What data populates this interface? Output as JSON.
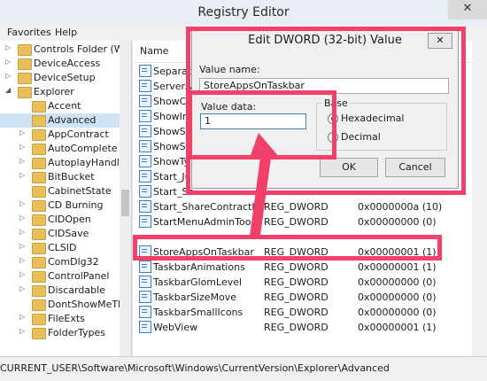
{
  "window": {
    "title": "Registry Editor",
    "close_glyph": "✕"
  },
  "menu": [
    "Favorites",
    "Help"
  ],
  "tree": [
    {
      "label": "Controls Folder (Wo",
      "level": 1,
      "arrow": "▷"
    },
    {
      "label": "DeviceAccess",
      "level": 1,
      "arrow": "▷"
    },
    {
      "label": "DeviceSetup",
      "level": 1,
      "arrow": "▷"
    },
    {
      "label": "Explorer",
      "level": 1,
      "arrow": "◢"
    },
    {
      "label": "Accent",
      "level": 2,
      "arrow": ""
    },
    {
      "label": "Advanced",
      "level": 2,
      "arrow": "",
      "selected": true
    },
    {
      "label": "AppContract",
      "level": 2,
      "arrow": "▷"
    },
    {
      "label": "AutoComplete",
      "level": 2,
      "arrow": "▷"
    },
    {
      "label": "AutoplayHandler",
      "level": 2,
      "arrow": "▷"
    },
    {
      "label": "BitBucket",
      "level": 2,
      "arrow": "▷"
    },
    {
      "label": "CabinetState",
      "level": 2,
      "arrow": ""
    },
    {
      "label": "CD Burning",
      "level": 2,
      "arrow": "▷"
    },
    {
      "label": "CIDOpen",
      "level": 2,
      "arrow": "▷"
    },
    {
      "label": "CIDSave",
      "level": 2,
      "arrow": "▷"
    },
    {
      "label": "CLSID",
      "level": 2,
      "arrow": "▷"
    },
    {
      "label": "ComDlg32",
      "level": 2,
      "arrow": "▷"
    },
    {
      "label": "ControlPanel",
      "level": 2,
      "arrow": "▷"
    },
    {
      "label": "Discardable",
      "level": 2,
      "arrow": "▷"
    },
    {
      "label": "DontShowMeThi",
      "level": 2,
      "arrow": ""
    },
    {
      "label": "FileExts",
      "level": 2,
      "arrow": "▷"
    },
    {
      "label": "FolderTypes",
      "level": 2,
      "arrow": "▷"
    }
  ],
  "list": {
    "header_name": "Name",
    "rows": [
      {
        "name": "Separat",
        "type": "",
        "data": ""
      },
      {
        "name": "ServerA",
        "type": "",
        "data": ""
      },
      {
        "name": "ShowCo",
        "type": "",
        "data": ""
      },
      {
        "name": "ShowInf",
        "type": "",
        "data": ""
      },
      {
        "name": "ShowSta",
        "type": "",
        "data": ""
      },
      {
        "name": "ShowSu",
        "type": "",
        "data": ""
      },
      {
        "name": "ShowTy",
        "type": "",
        "data": ""
      },
      {
        "name": "Start_Ju",
        "type": "",
        "data": ""
      },
      {
        "name": "Start_Se",
        "type": "",
        "data": ""
      },
      {
        "name": "Start_ShareContractH",
        "type": "REG_DWORD",
        "data": "0x0000000a (10)"
      },
      {
        "name": "StartMenuAdminToo",
        "type": "REG_DWORD",
        "data": "0x00000000 (0)"
      },
      {
        "name": "",
        "type": "",
        "data": ""
      },
      {
        "name": "StoreAppsOnTaskbar",
        "type": "REG_DWORD",
        "data": "0x00000001 (1)"
      },
      {
        "name": "TaskbarAnimations",
        "type": "REG_DWORD",
        "data": "0x00000001 (1)"
      },
      {
        "name": "TaskbarGlomLevel",
        "type": "REG_DWORD",
        "data": "0x00000000 (0)"
      },
      {
        "name": "TaskbarSizeMove",
        "type": "REG_DWORD",
        "data": "0x00000000 (0)"
      },
      {
        "name": "TaskbarSmallIcons",
        "type": "REG_DWORD",
        "data": "0x00000000 (0)"
      },
      {
        "name": "WebView",
        "type": "REG_DWORD",
        "data": "0x00000001 (1)"
      }
    ]
  },
  "status": {
    "path": "CURRENT_USER\\Software\\Microsoft\\Windows\\CurrentVersion\\Explorer\\Advanced"
  },
  "dialog": {
    "title": "Edit DWORD (32-bit) Value",
    "close_glyph": "✕",
    "value_name_label": "Value name:",
    "value_name": "StoreAppsOnTaskbar",
    "value_data_label": "Value data:",
    "value_data": "1",
    "base_label": "Base",
    "radio_hex": "Hexadecimal",
    "radio_dec": "Decimal",
    "ok": "OK",
    "cancel": "Cancel"
  },
  "colors": {
    "highlight": "#f2406b",
    "selection": "#cfe3f7"
  }
}
